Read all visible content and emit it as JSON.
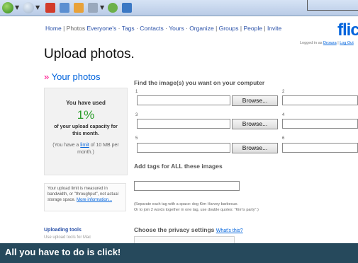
{
  "nav": {
    "home": "Home",
    "sep": "|",
    "photos": "Photos",
    "everyones": "Everyone's",
    "tags": "Tags",
    "contacts": "Contacts",
    "yours": "Yours",
    "organize": "Organize",
    "groups": "Groups",
    "people": "People",
    "invite": "Invite"
  },
  "logo": "flic",
  "logged_in": {
    "text": "Logged in as",
    "user": "Drowza",
    "logout": "Log Out"
  },
  "page_title": "Upload photos.",
  "your_photos": {
    "arrow": "»",
    "label": "Your photos"
  },
  "usage": {
    "you_have_used": "You have used",
    "percent": "1%",
    "of_capacity": "of your upload capacity for this month.",
    "limit_prefix": "(You have a",
    "limit_link": "limit",
    "limit_suffix": "of 10 MB per month.)"
  },
  "limit_note": {
    "text": "Your upload limit is measured in bandwidth, or \"throughput\", not actual storage space.",
    "more": "More information..."
  },
  "uploading_tools": {
    "title": "Uploading tools",
    "sub": "Use upload tools for Mac"
  },
  "find_label": "Find the image(s) you want on your computer",
  "file_slots": [
    {
      "num": "1",
      "browse": "Browse..."
    },
    {
      "num": "2",
      "browse": ""
    },
    {
      "num": "3",
      "browse": "Browse..."
    },
    {
      "num": "4",
      "browse": ""
    },
    {
      "num": "5",
      "browse": "Browse..."
    },
    {
      "num": "6",
      "browse": ""
    }
  ],
  "tags_label": "Add tags for ALL these images",
  "tags_input_value": "",
  "tags_help_1": "(Separate each tag with a space: dog Kim Harvey barbecue.",
  "tags_help_2": "Or to join 2 words together in one tag, use double quotes: \"Kim's party\".)",
  "privacy": {
    "label": "Choose the privacy settings",
    "link": "What's this?"
  },
  "banner": "All you have to do is click!",
  "colors": {
    "accent": "#0063dc",
    "pink": "#ff0084",
    "banner": "#26495c",
    "percent": "#2a9d2a"
  }
}
